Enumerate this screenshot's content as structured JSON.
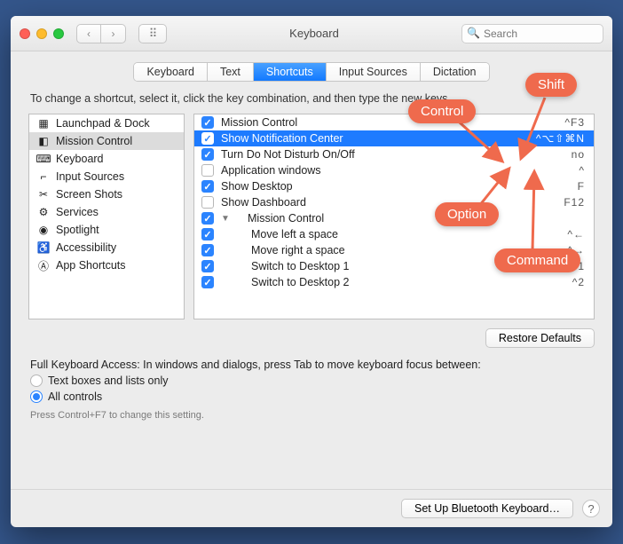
{
  "window_title": "Keyboard",
  "search_placeholder": "Search",
  "tabs": [
    "Keyboard",
    "Text",
    "Shortcuts",
    "Input Sources",
    "Dictation"
  ],
  "active_tab_index": 2,
  "instruction": "To change a shortcut, select it, click the key combination, and then type the new keys.",
  "categories": [
    {
      "icon": "▦",
      "label": "Launchpad & Dock"
    },
    {
      "icon": "◧",
      "label": "Mission Control",
      "selected": true
    },
    {
      "icon": "⌨",
      "label": "Keyboard"
    },
    {
      "icon": "⌐",
      "label": "Input Sources"
    },
    {
      "icon": "✂",
      "label": "Screen Shots"
    },
    {
      "icon": "⚙",
      "label": "Services"
    },
    {
      "icon": "◉",
      "label": "Spotlight"
    },
    {
      "icon": "♿",
      "label": "Accessibility"
    },
    {
      "icon": "Ⓐ",
      "label": "App Shortcuts"
    }
  ],
  "shortcuts": [
    {
      "checked": true,
      "label": "Mission Control",
      "shortcut": "^F3",
      "indent": 0
    },
    {
      "checked": true,
      "label": "Show Notification Center",
      "shortcut": "^⌥⇧⌘N",
      "indent": 0,
      "selected": true
    },
    {
      "checked": true,
      "label": "Turn Do Not Disturb On/Off",
      "shortcut": "no",
      "indent": 0,
      "dim": true
    },
    {
      "checked": false,
      "label": "Application windows",
      "shortcut": "^",
      "indent": 0,
      "dim": true
    },
    {
      "checked": true,
      "label": "Show Desktop",
      "shortcut": "F",
      "indent": 0
    },
    {
      "checked": false,
      "label": "Show Dashboard",
      "shortcut": "F12",
      "indent": 0,
      "dim": true
    },
    {
      "checked": true,
      "label": "Mission Control",
      "shortcut": "",
      "indent": 1,
      "disclosure": "▼"
    },
    {
      "checked": true,
      "label": "Move left a space",
      "shortcut": "^←",
      "indent": 2
    },
    {
      "checked": true,
      "label": "Move right a space",
      "shortcut": "^→",
      "indent": 2
    },
    {
      "checked": true,
      "label": "Switch to Desktop 1",
      "shortcut": "^1",
      "indent": 2
    },
    {
      "checked": true,
      "label": "Switch to Desktop 2",
      "shortcut": "^2",
      "indent": 2
    }
  ],
  "restore_label": "Restore Defaults",
  "fka_text": "Full Keyboard Access: In windows and dialogs, press Tab to move keyboard focus between:",
  "radio1": "Text boxes and lists only",
  "radio2": "All controls",
  "radio_selected": 1,
  "hint": "Press Control+F7 to change this setting.",
  "setup_bt": "Set Up Bluetooth Keyboard…",
  "annotations": {
    "control": "Control",
    "shift": "Shift",
    "option": "Option",
    "command": "Command"
  }
}
